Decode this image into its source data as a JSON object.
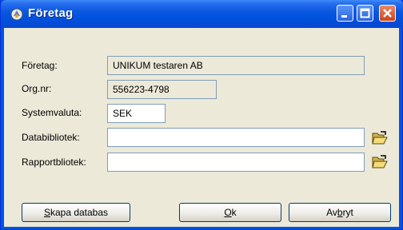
{
  "window": {
    "title": "Företag"
  },
  "form": {
    "foretag_label": "Företag:",
    "foretag_value": "UNIKUM testaren AB",
    "orgnr_label": "Org.nr:",
    "orgnr_value": "556223-4798",
    "valuta_label": "Systemvaluta:",
    "valuta_value": "SEK",
    "databibliotek_label": "Databibliotek:",
    "databibliotek_value": "",
    "rapportbibliotek_label": "Rapportbliotek:",
    "rapportbibliotek_value": ""
  },
  "buttons": {
    "skapa_pre": "S",
    "skapa_post": "kapa databas",
    "ok_pre": "O",
    "ok_post": "k",
    "avbryt_pre": "Av",
    "avbryt_mid": "b",
    "avbryt_post": "ryt"
  },
  "icons": {
    "folder": "open-folder-icon",
    "app": "app-icon"
  }
}
